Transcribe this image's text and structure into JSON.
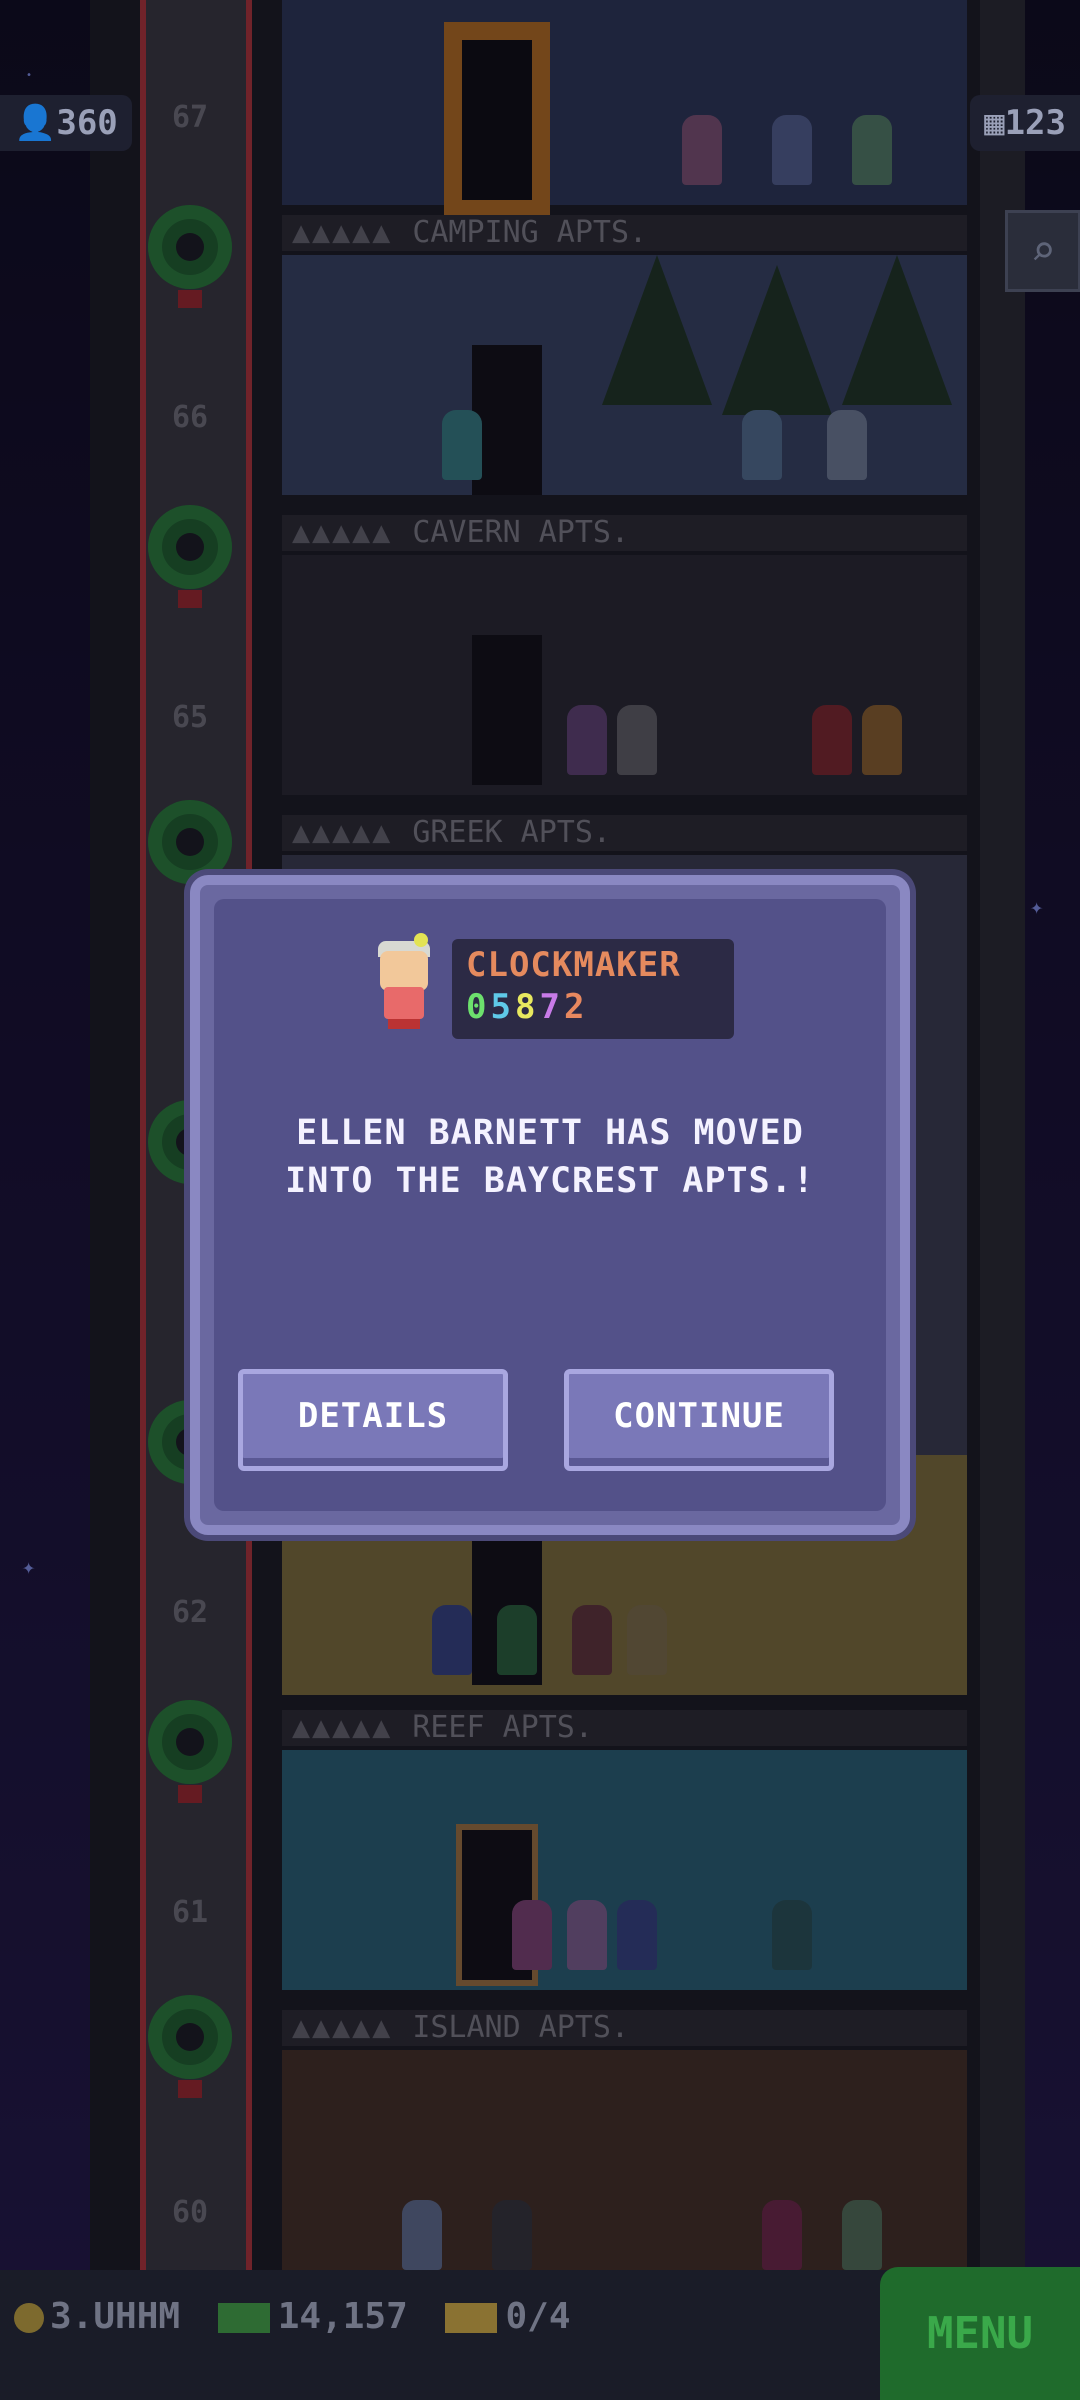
{
  "hud": {
    "population": "360",
    "floors": "123"
  },
  "floors": [
    {
      "number": "67",
      "label": ""
    },
    {
      "number": "66",
      "label": "CAMPING APTS."
    },
    {
      "number": "65",
      "label": "CAVERN APTS."
    },
    {
      "number": "62",
      "label": ""
    },
    {
      "number": "61",
      "label": "REEF APTS."
    },
    {
      "number": "60",
      "label": "ISLAND APTS."
    }
  ],
  "greek_label": "GREEK APTS.",
  "dialog": {
    "job": "CLOCKMAKER",
    "code_digits": [
      "0",
      "5",
      "8",
      "7",
      "2"
    ],
    "message_line1": "ELLEN BARNETT HAS MOVED",
    "message_line2": "INTO THE BAYCREST APTS.!",
    "details_label": "DETAILS",
    "continue_label": "CONTINUE"
  },
  "bottom": {
    "coins": "3.UHHM",
    "bux": "14,157",
    "tickets": "0/4",
    "menu_label": "MENU"
  },
  "colors": {
    "dialog_bg": "#535189",
    "dialog_border": "#8a88c2",
    "menu_bg": "#1f6b2c"
  }
}
